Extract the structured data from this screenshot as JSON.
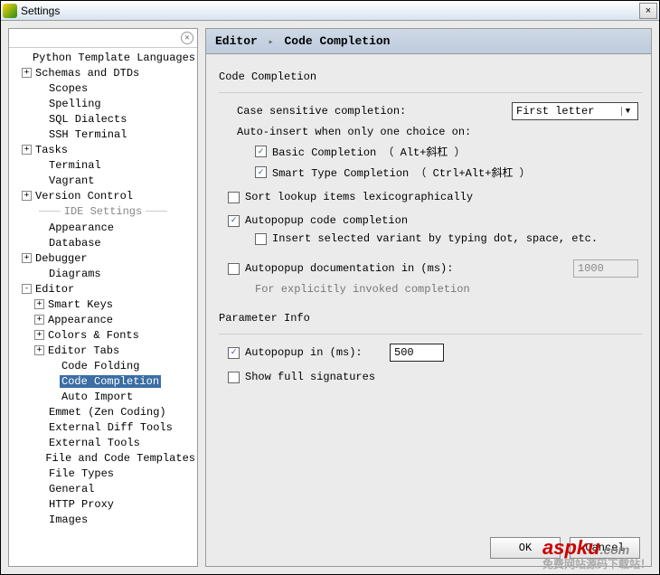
{
  "window": {
    "title": "Settings",
    "close": "×"
  },
  "search": {
    "placeholder": "",
    "clear": "⊘"
  },
  "tree": {
    "ide_settings_label": "IDE Settings",
    "items_top": [
      {
        "label": "Python Template Languages",
        "depth": 2,
        "exp": null
      },
      {
        "label": "Schemas and DTDs",
        "depth": 1,
        "exp": "+"
      },
      {
        "label": "Scopes",
        "depth": 2,
        "exp": null
      },
      {
        "label": "Spelling",
        "depth": 2,
        "exp": null
      },
      {
        "label": "SQL Dialects",
        "depth": 2,
        "exp": null
      },
      {
        "label": "SSH Terminal",
        "depth": 2,
        "exp": null
      },
      {
        "label": "Tasks",
        "depth": 1,
        "exp": "+"
      },
      {
        "label": "Terminal",
        "depth": 2,
        "exp": null
      },
      {
        "label": "Vagrant",
        "depth": 2,
        "exp": null
      },
      {
        "label": "Version Control",
        "depth": 1,
        "exp": "+"
      }
    ],
    "items_bottom": [
      {
        "label": "Appearance",
        "depth": 2,
        "exp": null
      },
      {
        "label": "Database",
        "depth": 2,
        "exp": null
      },
      {
        "label": "Debugger",
        "depth": 1,
        "exp": "+"
      },
      {
        "label": "Diagrams",
        "depth": 2,
        "exp": null
      },
      {
        "label": "Editor",
        "depth": 1,
        "exp": "-"
      },
      {
        "label": "Smart Keys",
        "depth": 2,
        "exp": "+"
      },
      {
        "label": "Appearance",
        "depth": 2,
        "exp": "+"
      },
      {
        "label": "Colors & Fonts",
        "depth": 2,
        "exp": "+"
      },
      {
        "label": "Editor Tabs",
        "depth": 2,
        "exp": "+"
      },
      {
        "label": "Code Folding",
        "depth": 3,
        "exp": null
      },
      {
        "label": "Code Completion",
        "depth": 3,
        "exp": null,
        "selected": true
      },
      {
        "label": "Auto Import",
        "depth": 3,
        "exp": null
      },
      {
        "label": "Emmet (Zen Coding)",
        "depth": 2,
        "exp": null
      },
      {
        "label": "External Diff Tools",
        "depth": 2,
        "exp": null
      },
      {
        "label": "External Tools",
        "depth": 2,
        "exp": null
      },
      {
        "label": "File and Code Templates",
        "depth": 2,
        "exp": null
      },
      {
        "label": "File Types",
        "depth": 2,
        "exp": null
      },
      {
        "label": "General",
        "depth": 2,
        "exp": null
      },
      {
        "label": "HTTP Proxy",
        "depth": 2,
        "exp": null
      },
      {
        "label": "Images",
        "depth": 2,
        "exp": null
      }
    ]
  },
  "breadcrumb": {
    "root": "Editor",
    "leaf": "Code Completion"
  },
  "sections": {
    "code_completion": "Code Completion",
    "parameter_info": "Parameter Info"
  },
  "fields": {
    "case_sensitive_label": "Case sensitive completion:",
    "case_sensitive_value": "First letter",
    "auto_insert_label": "Auto-insert when only one choice on:",
    "basic_completion": "Basic Completion （ Alt+斜杠 ）",
    "smart_completion": "Smart Type Completion （ Ctrl+Alt+斜杠 ）",
    "sort_lookup": "Sort lookup items lexicographically",
    "autopopup_code": "Autopopup code completion",
    "insert_variant": "Insert selected variant by typing dot, space, etc.",
    "autopopup_doc": "Autopopup documentation in (ms):",
    "autopopup_doc_value": "1000",
    "autopopup_doc_sub": "For explicitly invoked completion",
    "autopopup_in": "Autopopup in (ms):",
    "autopopup_in_value": "500",
    "show_full_sig": "Show full signatures"
  },
  "buttons": {
    "ok": "OK",
    "cancel": "Cancel"
  },
  "watermark": {
    "main": "aspku",
    "sub": "免费网站源码下载站！",
    "dot": ".com"
  }
}
